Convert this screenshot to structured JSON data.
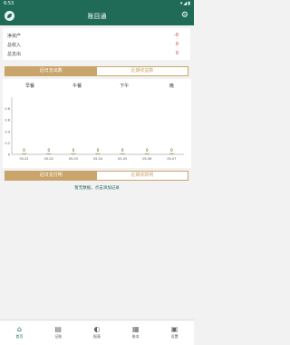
{
  "status_bar": {
    "time": "6:53",
    "icons": "▾◢▮"
  },
  "app": {
    "title": "账目通"
  },
  "summary": [
    {
      "label": "净资产",
      "value": "-0"
    },
    {
      "label": "总收入",
      "value": "0"
    },
    {
      "label": "总支出",
      "value": "0"
    }
  ],
  "top_tabs": [
    {
      "label": "近日支出数"
    },
    {
      "label": "近期收益数"
    }
  ],
  "chart_data": {
    "type": "bar",
    "column_headers": [
      "早餐",
      "午餐",
      "下午",
      "晚"
    ],
    "y_ticks": [
      "0.8",
      "0.6",
      "0.4",
      "0.2",
      "0"
    ],
    "ylim": [
      0,
      1
    ],
    "series": [
      {
        "values": [
          0,
          0,
          0,
          0,
          0,
          0,
          0
        ]
      }
    ],
    "data_labels": [
      "0",
      "0",
      "0",
      "0",
      "0",
      "0",
      "0"
    ],
    "categories": [
      "05-01",
      "05-02",
      "05-03",
      "05-04",
      "05-05",
      "05-06",
      "05-07"
    ],
    "bar_color": "#c9a56b"
  },
  "bottom_tabs": [
    {
      "label": "近日支付明"
    },
    {
      "label": "近期收款明"
    }
  ],
  "link_text": "暂无数据，点击添加记录",
  "nav": [
    {
      "label": "首页",
      "icon": "home-icon",
      "glyph": "⌂"
    },
    {
      "label": "记账",
      "icon": "note-icon",
      "glyph": "▤"
    },
    {
      "label": "报表",
      "icon": "chart-icon",
      "glyph": "◐"
    },
    {
      "label": "账本",
      "icon": "book-icon",
      "glyph": "▦"
    },
    {
      "label": "设置",
      "icon": "settings-icon",
      "glyph": "▣"
    }
  ],
  "colors": {
    "primary": "#1f6b58",
    "accent": "#c9a56b",
    "negative": "#d32f2f"
  }
}
